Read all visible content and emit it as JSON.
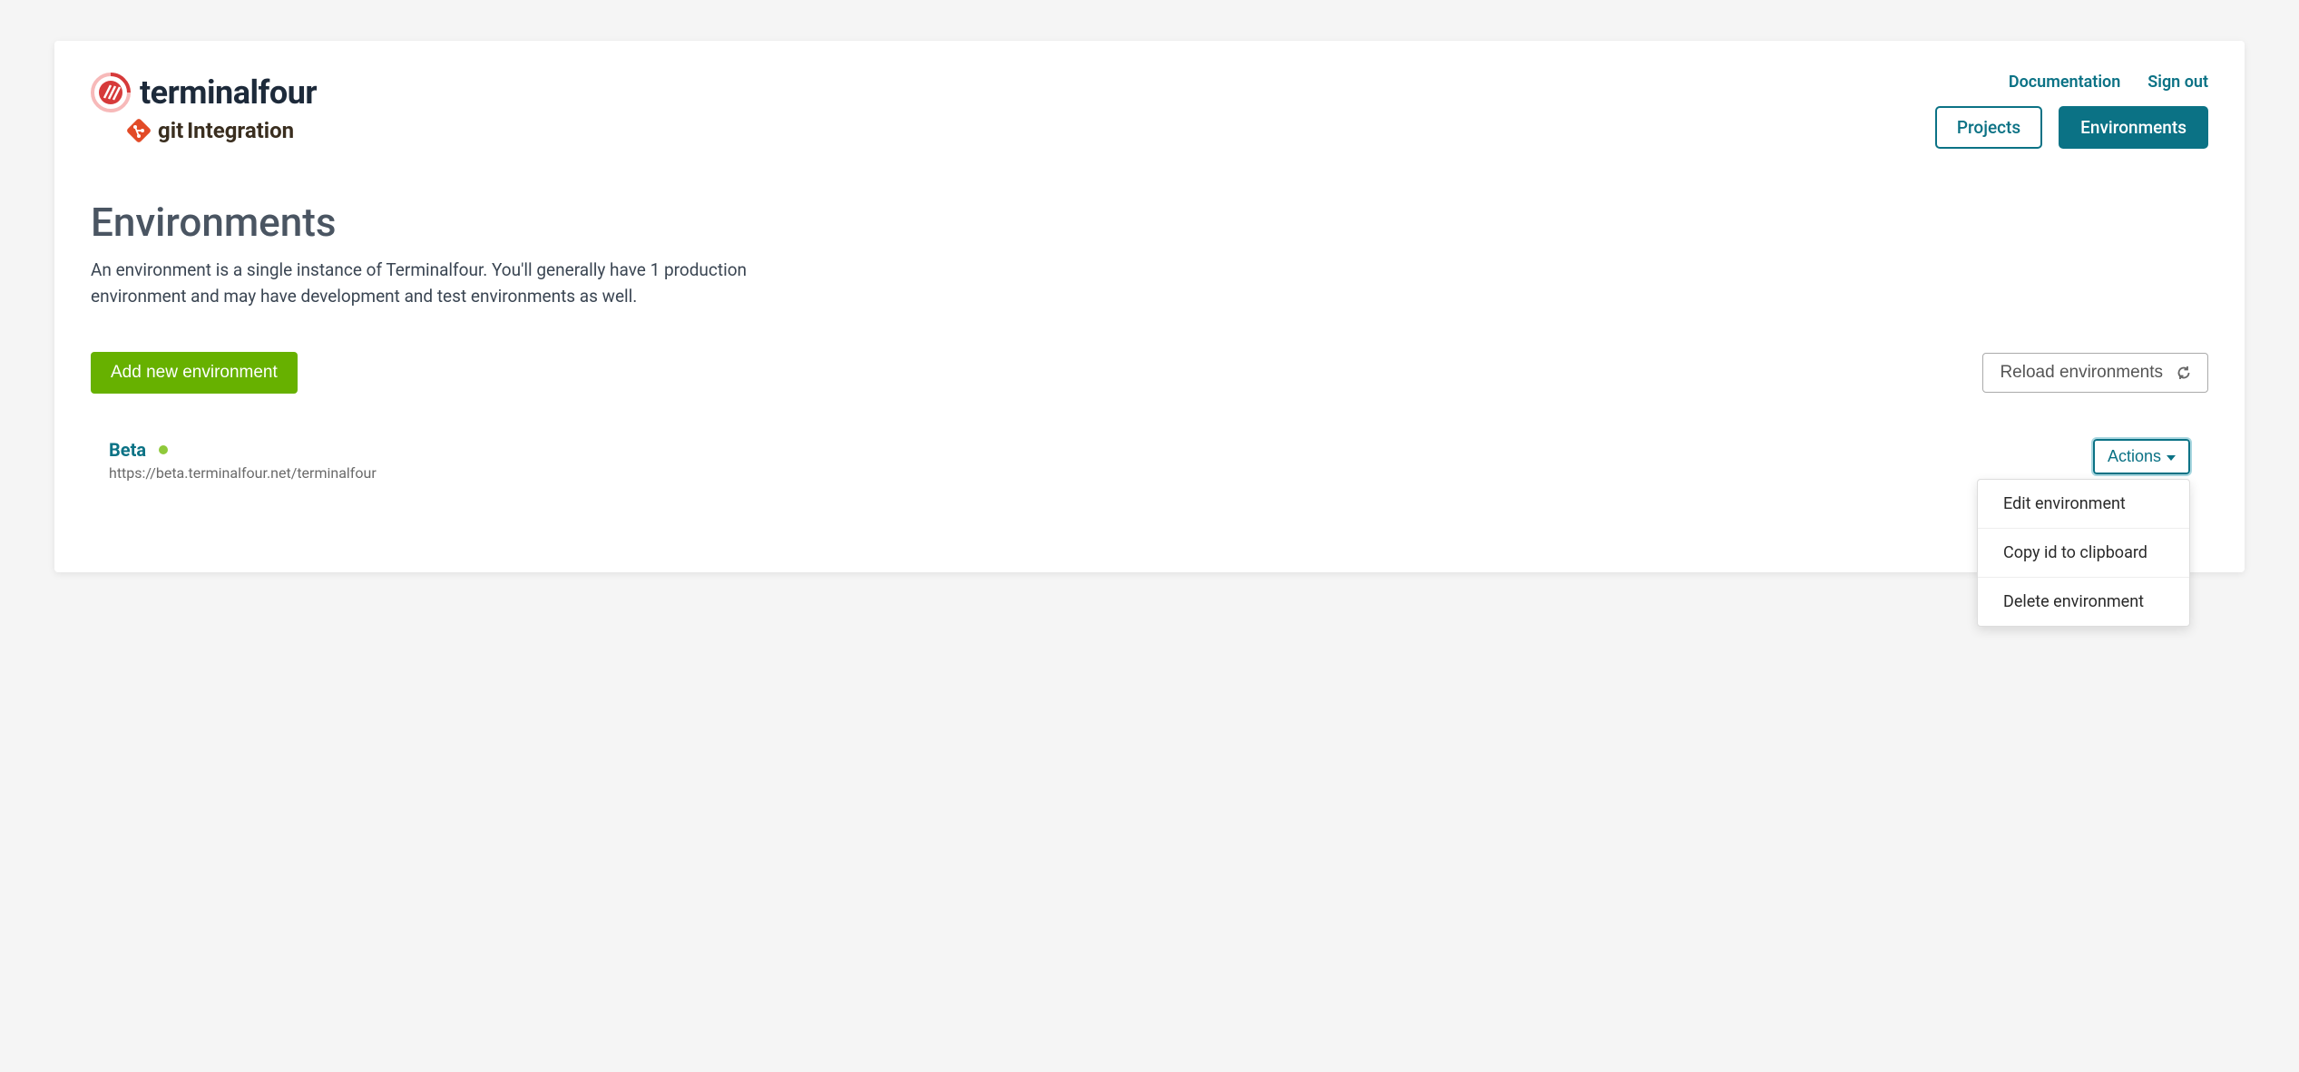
{
  "header": {
    "brand": "terminalfour",
    "subtitle_git": "git",
    "subtitle_integration": "Integration",
    "links": {
      "documentation": "Documentation",
      "sign_out": "Sign out"
    },
    "tabs": {
      "projects": "Projects",
      "environments": "Environments"
    }
  },
  "page": {
    "title": "Environments",
    "description": "An environment is a single instance of Terminalfour. You'll generally have 1 production environment and may have development and test environments as well."
  },
  "buttons": {
    "add_new": "Add new environment",
    "reload": "Reload environments",
    "actions": "Actions"
  },
  "environments": [
    {
      "name": "Beta",
      "url": "https://beta.terminalfour.net/terminalfour",
      "status": "online"
    }
  ],
  "dropdown": {
    "edit": "Edit environment",
    "copy_id": "Copy id to clipboard",
    "delete": "Delete environment"
  }
}
